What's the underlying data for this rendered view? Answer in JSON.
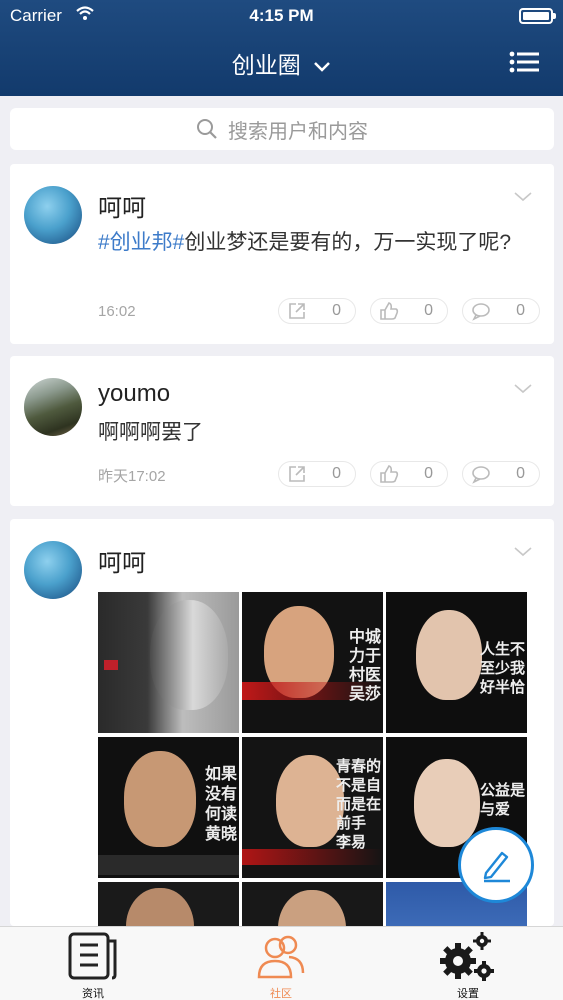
{
  "status_bar": {
    "carrier": "Carrier",
    "time": "4:15 PM"
  },
  "nav": {
    "title": "创业圈"
  },
  "search": {
    "placeholder": "搜索用户和内容"
  },
  "posts": [
    {
      "user": "呵呵",
      "tag": "#创业邦#",
      "text": "创业梦还是要有的，万一实现了呢?",
      "time": "16:02",
      "shares": "0",
      "likes": "0",
      "comments": "0"
    },
    {
      "user": "youmo",
      "text": "啊啊啊罢了",
      "time": "昨天17:02",
      "shares": "0",
      "likes": "0",
      "comments": "0"
    },
    {
      "user": "呵呵",
      "photo_captions": [
        "",
        "中城\n力于\n村医\n吴莎",
        "人生不\n至少我\n好半恰",
        "如果\n没有\n何读\n黄晓",
        "青春的\n不是自\n而是在\n前手\n李易",
        "公益是\n与爱\n"
      ]
    }
  ],
  "tabbar": {
    "items": [
      {
        "label": "资讯"
      },
      {
        "label": "社区"
      },
      {
        "label": "设置"
      }
    ]
  },
  "colors": {
    "header": "#1a4476",
    "accent": "#ef8a52",
    "tag": "#3d7bc9",
    "fab_border": "#1e88d8"
  }
}
